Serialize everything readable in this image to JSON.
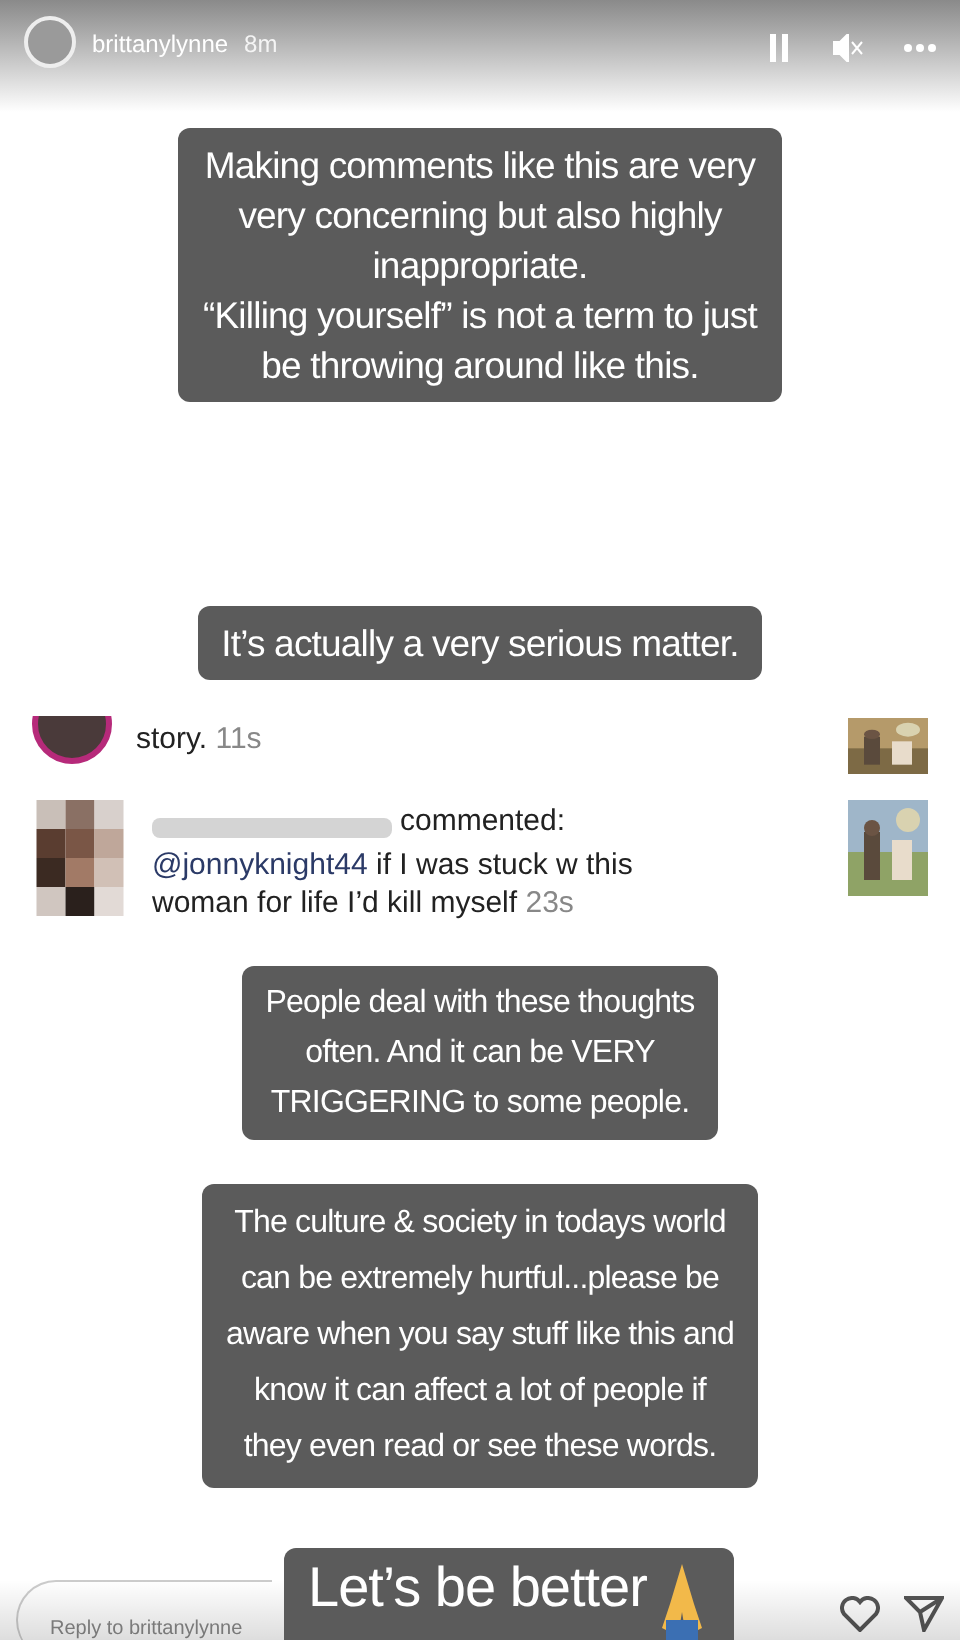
{
  "story_header": {
    "username": "brittanylynne",
    "time": "8m"
  },
  "captions_top": [
    {
      "lines": [
        "Making comments like this are very",
        "very concerning but also highly",
        "inappropriate.",
        "“Killing yourself” is not a term to just",
        "be throwing around like this."
      ]
    },
    {
      "lines": [
        "It’s actually a very serious matter."
      ]
    }
  ],
  "comments": [
    {
      "kind": "partial",
      "text": "story.",
      "time": "11s"
    },
    {
      "kind": "full",
      "verb": "commented:",
      "mention": "@jonnyknight44",
      "text": "if I was stuck w this woman for life I’d kill myself",
      "time": "23s"
    }
  ],
  "captions_bottom": [
    {
      "lines": [
        "People deal with these thoughts",
        "often. And it can be VERY",
        "TRIGGERING to some people."
      ]
    },
    {
      "lines": [
        "The culture & society in todays world",
        "can be extremely hurtful...please be",
        "aware when you say stuff like this and",
        "know it can affect a lot of people if",
        "they even read or see these words."
      ]
    }
  ],
  "sticker": {
    "text": "Let’s be better"
  },
  "reply": {
    "placeholder": "Reply to brittanylynne"
  }
}
